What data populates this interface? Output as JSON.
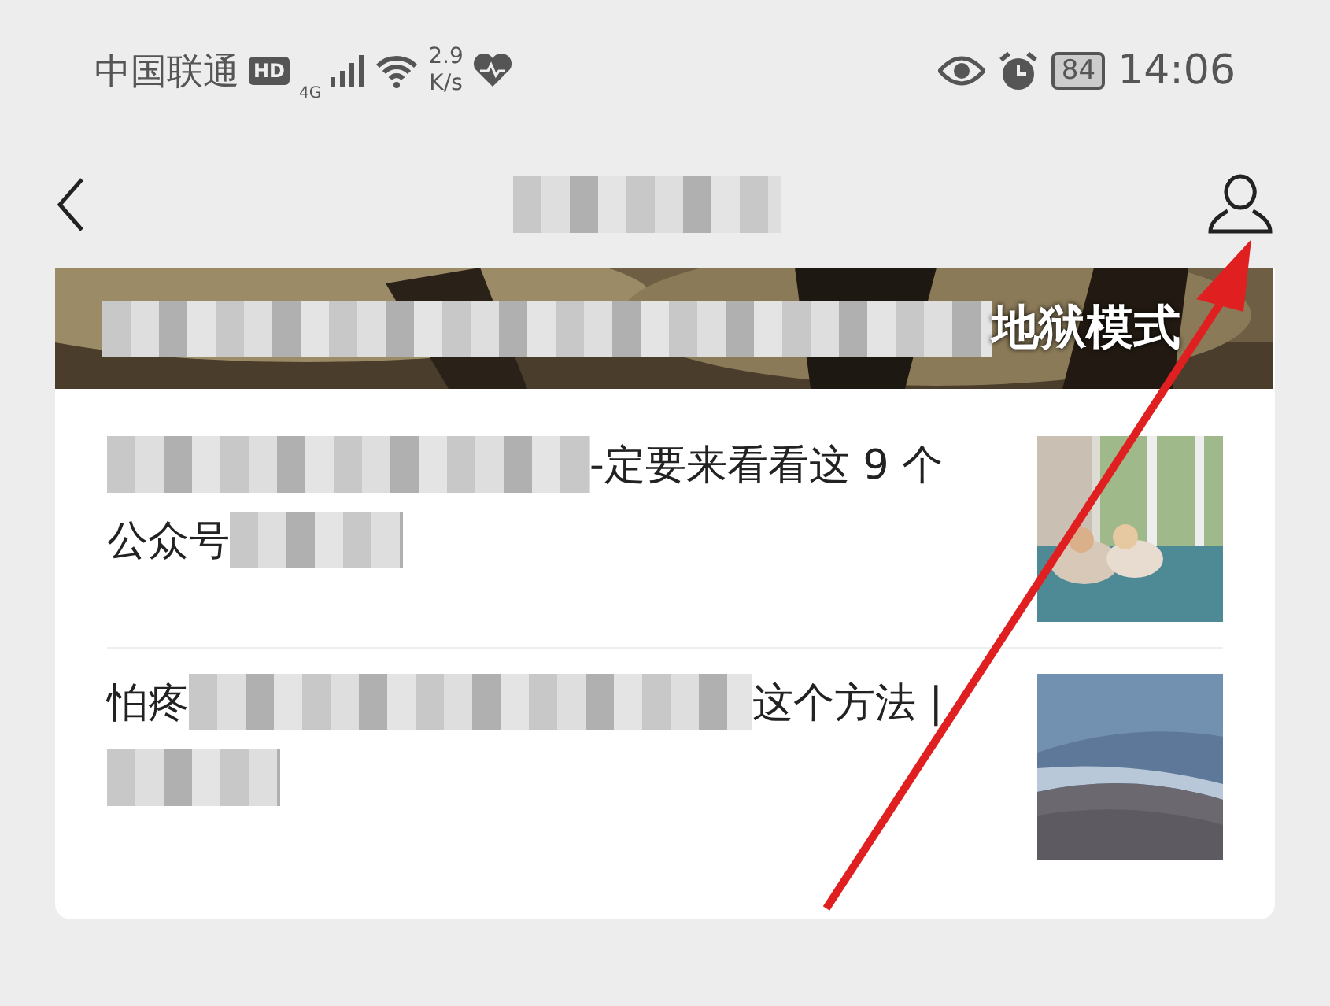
{
  "status_bar": {
    "carrier": "中国联通",
    "hd": "HD",
    "network": "4G",
    "speed_value": "2.9",
    "speed_unit": "K/s",
    "battery": "84",
    "time": "14:06"
  },
  "nav": {
    "title": {
      "kind": "blur"
    }
  },
  "banner": {
    "kind": "picture",
    "segments": [
      {
        "kind": "blur"
      },
      {
        "kind": "text",
        "text": "地狱模式"
      }
    ]
  },
  "articles": [
    {
      "lines": [
        [
          {
            "kind": "blur"
          },
          {
            "kind": "text",
            "text": "-定要来看看这 9 个"
          }
        ],
        [
          {
            "kind": "text",
            "text": "公众号"
          },
          {
            "kind": "blur"
          }
        ]
      ],
      "thumbnail": {
        "kind": "picture"
      }
    },
    {
      "lines": [
        [
          {
            "kind": "text",
            "text": "怕疼"
          },
          {
            "kind": "blur"
          },
          {
            "kind": "text",
            "text": "这个方法 |"
          }
        ],
        [
          {
            "kind": "blur"
          }
        ]
      ],
      "thumbnail": {
        "kind": "picture"
      }
    }
  ],
  "annotation": {
    "kind": "arrow",
    "color": "#e02020"
  }
}
